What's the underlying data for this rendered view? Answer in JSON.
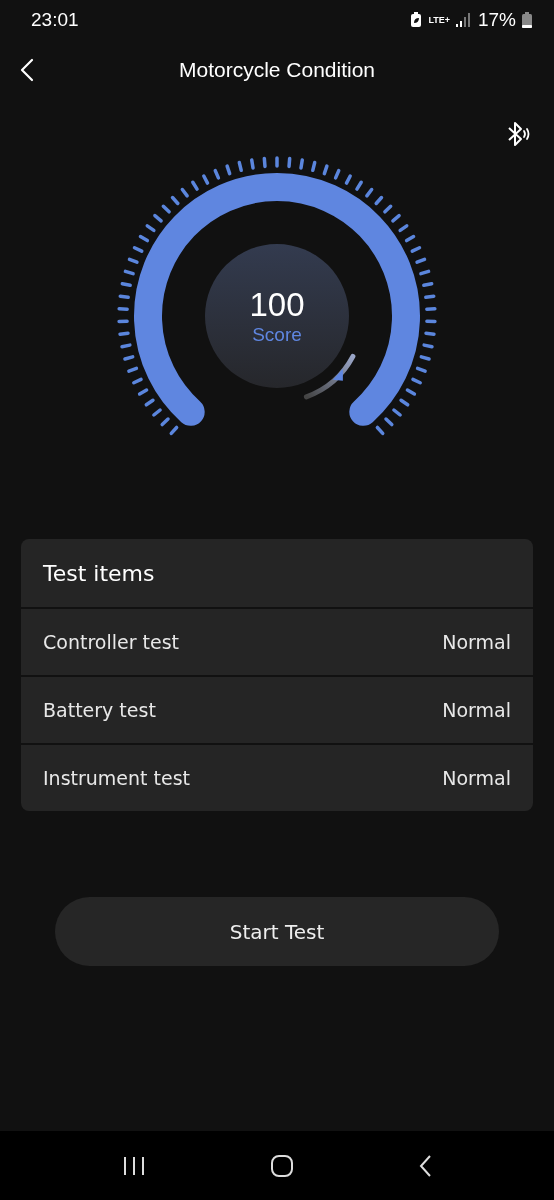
{
  "status_bar": {
    "time": "23:01",
    "network": "LTE+",
    "battery": "17%"
  },
  "header": {
    "title": "Motorcycle Condition"
  },
  "gauge": {
    "score": "100",
    "label": "Score"
  },
  "test_items": {
    "title": "Test items",
    "rows": [
      {
        "name": "Controller test",
        "result": "Normal"
      },
      {
        "name": "Battery test",
        "result": "Normal"
      },
      {
        "name": "Instrument test",
        "result": "Normal"
      }
    ]
  },
  "buttons": [
    "Start Test"
  ]
}
